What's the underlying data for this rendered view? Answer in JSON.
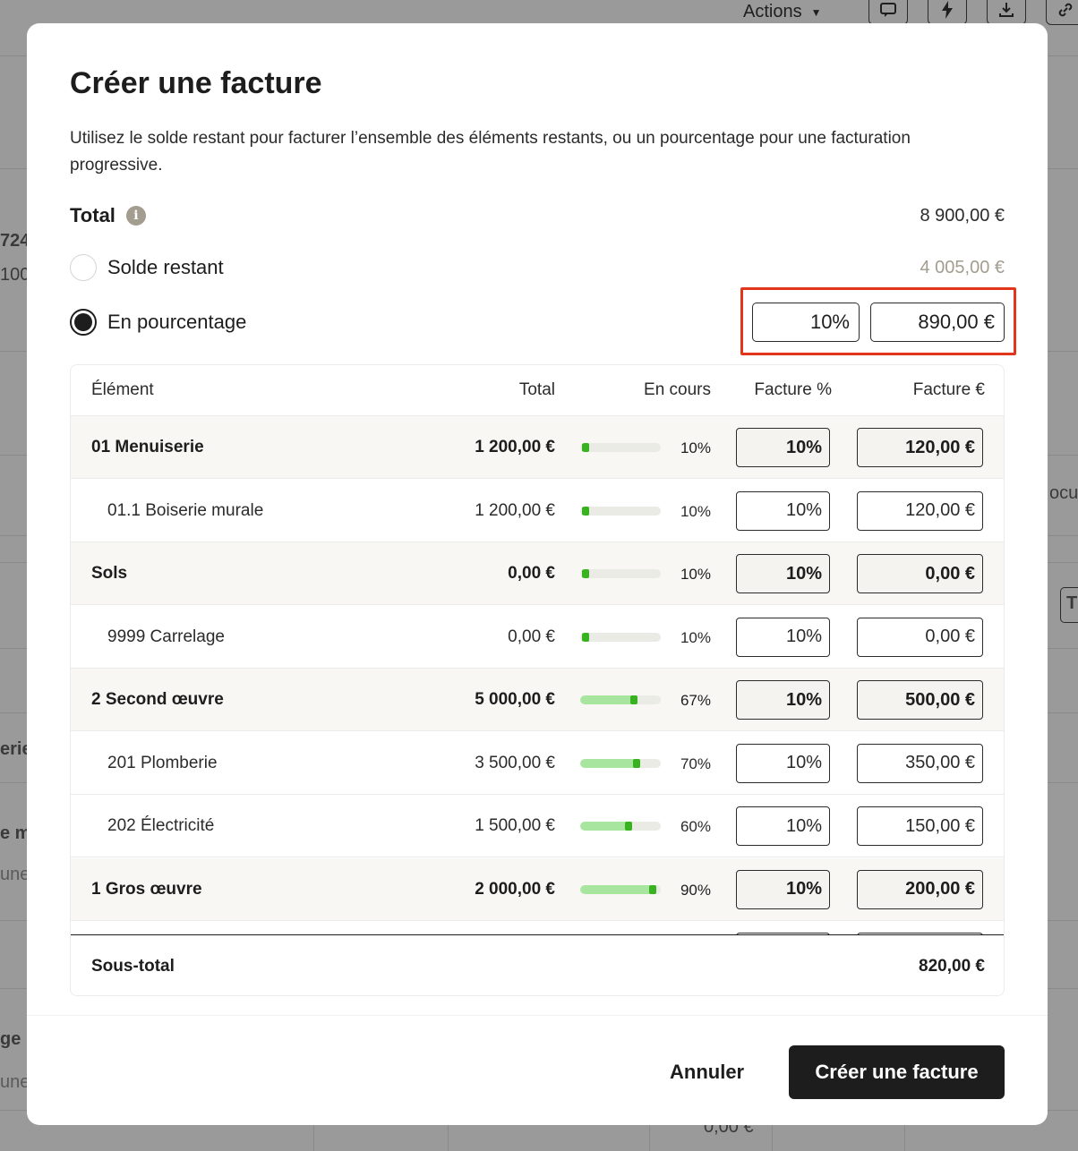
{
  "background": {
    "actions_label": "Actions",
    "fragments": [
      "724",
      "100",
      "ocun",
      "erie",
      "e mu",
      "une",
      "ge",
      "une",
      "0,00 €",
      "T"
    ]
  },
  "modal": {
    "title": "Créer une facture",
    "description": "Utilisez le solde restant pour facturer l’ensemble des éléments restants, ou un pourcentage pour une facturation progressive.",
    "total_label": "Total",
    "total_value": "8 900,00 €",
    "option_remaining_label": "Solde restant",
    "option_remaining_value": "4 005,00 €",
    "option_percentage_label": "En pourcentage",
    "percentage_input": "10%",
    "amount_input": "890,00 €"
  },
  "table": {
    "headers": {
      "element": "Élément",
      "total": "Total",
      "in_progress": "En cours",
      "invoice_pct": "Facture %",
      "invoice_eur": "Facture €"
    },
    "rows": [
      {
        "name": "01 Menuiserie",
        "total": "1 200,00 €",
        "progress": 10,
        "progress_label": "10%",
        "invoice_pct": "10%",
        "invoice_eur": "120,00 €",
        "group": true
      },
      {
        "name": "01.1 Boiserie murale",
        "total": "1 200,00 €",
        "progress": 10,
        "progress_label": "10%",
        "invoice_pct": "10%",
        "invoice_eur": "120,00 €",
        "group": false
      },
      {
        "name": "Sols",
        "total": "0,00 €",
        "progress": 10,
        "progress_label": "10%",
        "invoice_pct": "10%",
        "invoice_eur": "0,00 €",
        "group": true
      },
      {
        "name": "9999 Carrelage",
        "total": "0,00 €",
        "progress": 10,
        "progress_label": "10%",
        "invoice_pct": "10%",
        "invoice_eur": "0,00 €",
        "group": false
      },
      {
        "name": "2 Second œuvre",
        "total": "5 000,00 €",
        "progress": 67,
        "progress_label": "67%",
        "invoice_pct": "10%",
        "invoice_eur": "500,00 €",
        "group": true
      },
      {
        "name": "201 Plomberie",
        "total": "3 500,00 €",
        "progress": 70,
        "progress_label": "70%",
        "invoice_pct": "10%",
        "invoice_eur": "350,00 €",
        "group": false
      },
      {
        "name": "202 Électricité",
        "total": "1 500,00 €",
        "progress": 60,
        "progress_label": "60%",
        "invoice_pct": "10%",
        "invoice_eur": "150,00 €",
        "group": false
      },
      {
        "name": "1 Gros œuvre",
        "total": "2 000,00 €",
        "progress": 90,
        "progress_label": "90%",
        "invoice_pct": "10%",
        "invoice_eur": "200,00 €",
        "group": true
      }
    ],
    "subtotal_label": "Sous-total",
    "subtotal_value": "820,00 €"
  },
  "footer": {
    "cancel_label": "Annuler",
    "submit_label": "Créer une facture"
  }
}
